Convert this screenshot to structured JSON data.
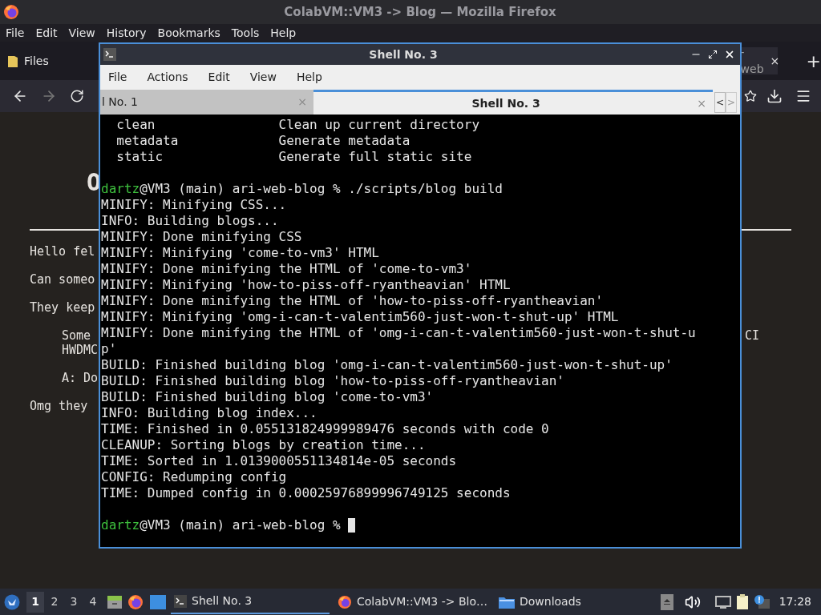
{
  "browser": {
    "title": "ColabVM::VM3 -> Blog — Mozilla Firefox",
    "menu": [
      "File",
      "Edit",
      "View",
      "History",
      "Bookmarks",
      "Tools",
      "Help"
    ],
    "tabs": [
      {
        "label": "Files",
        "selected": false
      },
      {
        "label": "-web",
        "close": "×",
        "selected": true
      }
    ],
    "new_tab": "+",
    "page": {
      "heading": "O",
      "paragraphs": [
        {
          "text": "Hello fel",
          "indent": false
        },
        {
          "text": "Can someo",
          "indent": false
        },
        {
          "text": "They keep",
          "indent": false
        },
        {
          "text": "Some",
          "right": "CI",
          "indent": true
        },
        {
          "text": "HWDMC",
          "indent": true
        },
        {
          "text": "A: Do",
          "indent": true
        },
        {
          "text": "Omg they",
          "indent": false
        }
      ]
    }
  },
  "terminal": {
    "title": "Shell No. 3",
    "menu": [
      "File",
      "Actions",
      "Edit",
      "View",
      "Help"
    ],
    "tabs": [
      {
        "label": "l No. 1",
        "close": "×",
        "selected": false
      },
      {
        "label": "Shell No. 3",
        "close": "×",
        "selected": true
      }
    ],
    "scroll_left": "<",
    "scroll_right": ">",
    "lines": [
      {
        "kind": "output",
        "text": "  clean                Clean up current directory"
      },
      {
        "kind": "output",
        "text": "  metadata             Generate metadata"
      },
      {
        "kind": "output",
        "text": "  static               Generate full static site"
      },
      {
        "kind": "blank"
      },
      {
        "kind": "prompt",
        "user": "dartz",
        "text": "@VM3 (main) ari-web-blog % ./scripts/blog build",
        "cursor": false
      },
      {
        "kind": "output",
        "text": "MINIFY: Minifying CSS..."
      },
      {
        "kind": "output",
        "text": "INFO: Building blogs..."
      },
      {
        "kind": "output",
        "text": "MINIFY: Done minifying CSS"
      },
      {
        "kind": "output",
        "text": "MINIFY: Minifying 'come-to-vm3' HTML"
      },
      {
        "kind": "output",
        "text": "MINIFY: Done minifying the HTML of 'come-to-vm3'"
      },
      {
        "kind": "output",
        "text": "MINIFY: Minifying 'how-to-piss-off-ryantheavian' HTML"
      },
      {
        "kind": "output",
        "text": "MINIFY: Done minifying the HTML of 'how-to-piss-off-ryantheavian'"
      },
      {
        "kind": "output",
        "text": "MINIFY: Minifying 'omg-i-can-t-valentim560-just-won-t-shut-up' HTML"
      },
      {
        "kind": "output",
        "text": "MINIFY: Done minifying the HTML of 'omg-i-can-t-valentim560-just-won-t-shut-u"
      },
      {
        "kind": "output",
        "text": "p'"
      },
      {
        "kind": "output",
        "text": "BUILD: Finished building blog 'omg-i-can-t-valentim560-just-won-t-shut-up'"
      },
      {
        "kind": "output",
        "text": "BUILD: Finished building blog 'how-to-piss-off-ryantheavian'"
      },
      {
        "kind": "output",
        "text": "BUILD: Finished building blog 'come-to-vm3'"
      },
      {
        "kind": "output",
        "text": "INFO: Building blog index..."
      },
      {
        "kind": "output",
        "text": "TIME: Finished in 0.055131824999989476 seconds with code 0"
      },
      {
        "kind": "output",
        "text": "CLEANUP: Sorting blogs by creation time..."
      },
      {
        "kind": "output",
        "text": "TIME: Sorted in 1.0139000551134814e-05 seconds"
      },
      {
        "kind": "output",
        "text": "CONFIG: Redumping config"
      },
      {
        "kind": "output",
        "text": "TIME: Dumped config in 0.00025976899996749125 seconds"
      },
      {
        "kind": "blank"
      },
      {
        "kind": "prompt",
        "user": "dartz",
        "text": "@VM3 (main) ari-web-blog % ",
        "cursor": true
      }
    ]
  },
  "taskbar": {
    "workspaces": [
      {
        "label": "1",
        "selected": true
      },
      {
        "label": "2",
        "selected": false
      },
      {
        "label": "3",
        "selected": false
      },
      {
        "label": "4",
        "selected": false
      }
    ],
    "tasks": [
      {
        "label": "Shell No. 3",
        "kind": "terminal",
        "selected": true
      },
      {
        "label": "ColabVM::VM3 -> Blo…",
        "kind": "browser",
        "selected": false
      },
      {
        "label": "Downloads",
        "kind": "folder",
        "selected": false
      }
    ],
    "clock": "17:28"
  }
}
